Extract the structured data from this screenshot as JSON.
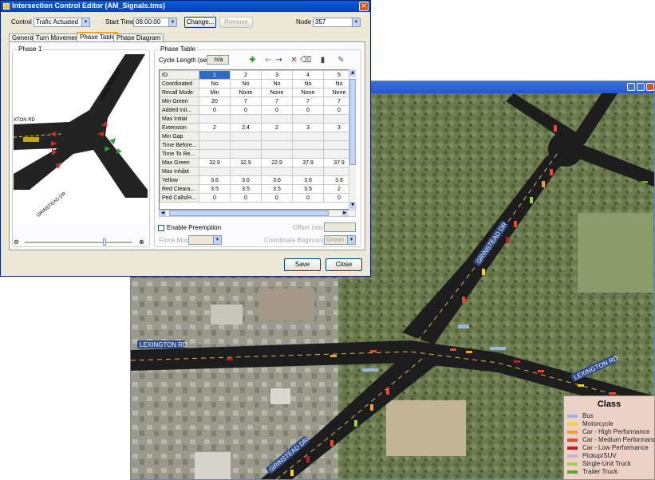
{
  "dialog": {
    "title": "Intersection Control Editor (AM_Signals.tms)",
    "close_glyph": "×",
    "control_label": "Control",
    "control_value": "Trafic Actuated",
    "start_time_label": "Start Time",
    "start_time_value": "08:00:00",
    "change_button": "Change...",
    "remove_button": "Remove",
    "node_label": "Node",
    "node_value": "357",
    "tabs": [
      "General",
      "Turn Movement",
      "Phase Table",
      "Phase Diagram"
    ],
    "phase_group_title": "Phase 1",
    "table_group_title": "Phase Table",
    "cycle_length_label": "Cycle Length (sec)",
    "cycle_length_value": "n/a",
    "enable_preemption_label": "Enable Preemption",
    "force_mode_label": "Force Mode",
    "coordinate_label": "Coordinate Beginning of",
    "coordinate_value": "Green",
    "offset_label": "Offset (sec)",
    "save_button": "Save",
    "close_button": "Close",
    "map_labels": {
      "top": "GRINSTEAD DR",
      "left": "XTON RD",
      "bottom": "GRINSTEAD DR"
    }
  },
  "phase_table": {
    "rows": [
      {
        "label": "ID",
        "values": [
          "1",
          "2",
          "3",
          "4",
          "5"
        ]
      },
      {
        "label": "Coordinated",
        "values": [
          "No",
          "No",
          "No",
          "No",
          "No"
        ]
      },
      {
        "label": "Recall Mode",
        "values": [
          "Min",
          "None",
          "None",
          "None",
          "None"
        ]
      },
      {
        "label": "Min Green",
        "values": [
          "20",
          "7",
          "7",
          "7",
          "7"
        ]
      },
      {
        "label": "Added Init...",
        "values": [
          "0",
          "0",
          "0",
          "0",
          "0"
        ]
      },
      {
        "label": "Max Initial",
        "values": [
          "",
          "",
          "",
          "",
          ""
        ]
      },
      {
        "label": "Extension",
        "values": [
          "2",
          "2.4",
          "2",
          "3",
          "3"
        ]
      },
      {
        "label": "Min Gap",
        "values": [
          "",
          "",
          "",
          "",
          ""
        ]
      },
      {
        "label": "Time Before...",
        "values": [
          "",
          "",
          "",
          "",
          ""
        ]
      },
      {
        "label": "Time To Re...",
        "values": [
          "",
          "",
          "",
          "",
          ""
        ]
      },
      {
        "label": "Max Green",
        "values": [
          "32.9",
          "32.9",
          "22.9",
          "37.9",
          "37.9"
        ]
      },
      {
        "label": "Max Inhibit",
        "values": [
          "",
          "",
          "",
          "",
          ""
        ]
      },
      {
        "label": "Yellow",
        "values": [
          "3.6",
          "3.6",
          "3.6",
          "3.6",
          "3.6"
        ]
      },
      {
        "label": "Red Cleara...",
        "values": [
          "3.5",
          "3.5",
          "3.5",
          "3.5",
          "2"
        ]
      },
      {
        "label": "Ped Calls/H...",
        "values": [
          "0",
          "0",
          "0",
          "0",
          "0"
        ]
      }
    ]
  },
  "map": {
    "labels": [
      "LEXINGTON RD",
      "LEXINGTON RD",
      "GRINSTEAD DR",
      "GRINSTEAD DR"
    ]
  },
  "legend": {
    "title": "Class",
    "items": [
      {
        "label": "Bus",
        "color": "#9fb4d9"
      },
      {
        "label": "Motorcycle",
        "color": "#f2d038"
      },
      {
        "label": "Car - High Performance",
        "color": "#f0a030"
      },
      {
        "label": "Car - Medium Performance",
        "color": "#e84a2c"
      },
      {
        "label": "Car - Low Performance",
        "color": "#b8222a"
      },
      {
        "label": "Pickup/SUV",
        "color": "#c9b2cc"
      },
      {
        "label": "Single-Unit Truck",
        "color": "#9bd34a"
      },
      {
        "label": "Trailer Truck",
        "color": "#5aa832"
      }
    ]
  }
}
